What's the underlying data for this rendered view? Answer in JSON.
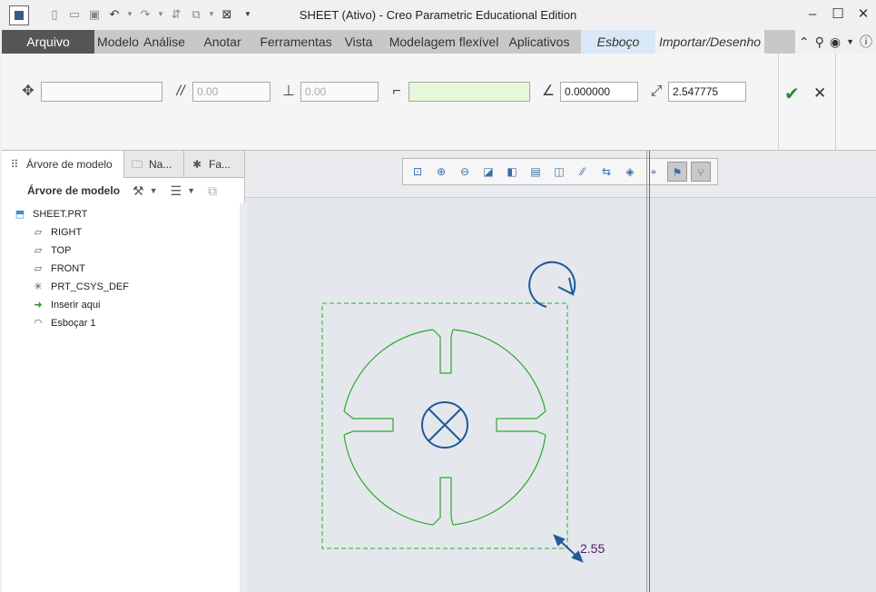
{
  "window": {
    "title": "SHEET (Ativo) - Creo Parametric Educational Edition"
  },
  "menu": {
    "tabs": [
      "Modelo",
      "Análise",
      "Anotar",
      "Ferramentas",
      "Vista",
      "Modelagem flexível",
      "Aplicativos"
    ],
    "file": "Arquivo",
    "sketch_tab": "Esboço",
    "import_tab": "Importar/Desenho"
  },
  "dashboard": {
    "field1": "",
    "field2": "0.00",
    "field3": "0.00",
    "field4": "",
    "angle": "0.000000",
    "scale": "2.547775"
  },
  "left_panel": {
    "tabs": [
      "Árvore de modelo",
      "Na...",
      "Fa..."
    ],
    "toolbar_title": "Árvore de modelo",
    "tree": [
      {
        "label": "SHEET.PRT",
        "icon": "part-icon",
        "level": 0
      },
      {
        "label": "RIGHT",
        "icon": "datum-plane-icon",
        "level": 1
      },
      {
        "label": "TOP",
        "icon": "datum-plane-icon",
        "level": 1
      },
      {
        "label": "FRONT",
        "icon": "datum-plane-icon",
        "level": 1
      },
      {
        "label": "PRT_CSYS_DEF",
        "icon": "csys-icon",
        "level": 1
      },
      {
        "label": "Inserir aqui",
        "icon": "insert-arrow-icon",
        "level": 1
      },
      {
        "label": "Esboçar 1",
        "icon": "sketch-icon",
        "level": 1
      }
    ]
  },
  "graphics": {
    "scale_label": "2.55"
  },
  "colors": {
    "sketch_green": "#2ea82e",
    "handle_blue": "#1f5a9a",
    "file_tab": "#555555",
    "sketch_tab_bg": "#d8e8f6"
  }
}
